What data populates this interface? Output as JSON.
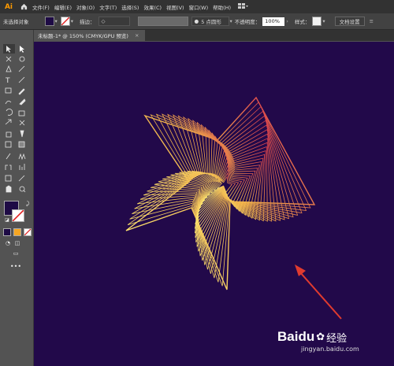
{
  "app": {
    "logo": "Ai"
  },
  "menu": [
    "文件(F)",
    "编辑(E)",
    "对象(O)",
    "文字(T)",
    "选择(S)",
    "效果(C)",
    "视图(V)",
    "窗口(W)",
    "帮助(H)"
  ],
  "control": {
    "selection": "未选择对象",
    "stroke_label": "描边：",
    "stroke_stepper": "◇",
    "brush": "5 点圆形",
    "opacity_label": "不透明度：",
    "opacity_value": "100%",
    "style_label": "样式：",
    "doc_setup": "文档设置"
  },
  "tab": {
    "title": "未标题-1* @ 150% (CMYK/GPU 预览)",
    "close": "×"
  },
  "colors": {
    "background_canvas": "#22094a",
    "fill": "#1e0b45",
    "stroke": "#ffffff",
    "gradient_start": "#fff27a",
    "gradient_end": "#d6204e",
    "arrow": "#e03b2f"
  },
  "icons": [
    "home-icon",
    "selection-tool-icon",
    "direct-select-icon",
    "pen-icon",
    "type-icon",
    "line-icon",
    "brush-icon",
    "pencil-icon",
    "eraser-icon",
    "rotate-icon",
    "scale-icon",
    "eyedropper-icon",
    "blend-icon",
    "graph-icon",
    "artboard-icon",
    "hand-icon",
    "zoom-icon",
    "more-tools-icon"
  ],
  "watermark": {
    "brand": "Baidu",
    "suffix": "经验",
    "url": "jingyan.baidu.com"
  }
}
